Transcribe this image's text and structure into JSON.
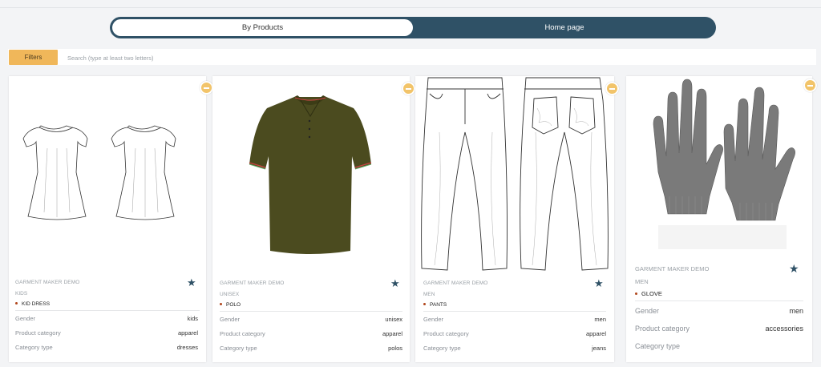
{
  "toggle": {
    "active_label": "By Products",
    "inactive_label": "Home page"
  },
  "filters": {
    "button_label": "Filters",
    "search_placeholder": "Search (type at least two letters)"
  },
  "attr_labels": {
    "gender": "Gender",
    "product_category": "Product category",
    "category_type": "Category type"
  },
  "colors": {
    "accent": "#2f5166",
    "filters_button": "#f0b75a",
    "dot": "#b0461b"
  },
  "cards": [
    {
      "brand": "GARMENT MAKER DEMO",
      "gender_tag": "KIDS",
      "name": "KID DRESS",
      "gender": "kids",
      "product_category": "apparel",
      "category_type": "dresses",
      "favorite": true
    },
    {
      "brand": "GARMENT MAKER DEMO",
      "gender_tag": "UNISEX",
      "name": "POLO",
      "gender": "unisex",
      "product_category": "apparel",
      "category_type": "polos",
      "favorite": true
    },
    {
      "brand": "GARMENT MAKER DEMO",
      "gender_tag": "MEN",
      "name": "PANTS",
      "gender": "men",
      "product_category": "apparel",
      "category_type": "jeans",
      "favorite": true
    },
    {
      "brand": "GARMENT MAKER DEMO",
      "gender_tag": "MEN",
      "name": "GLOVE",
      "gender": "men",
      "product_category": "accessories",
      "category_type": "",
      "favorite": true
    }
  ]
}
